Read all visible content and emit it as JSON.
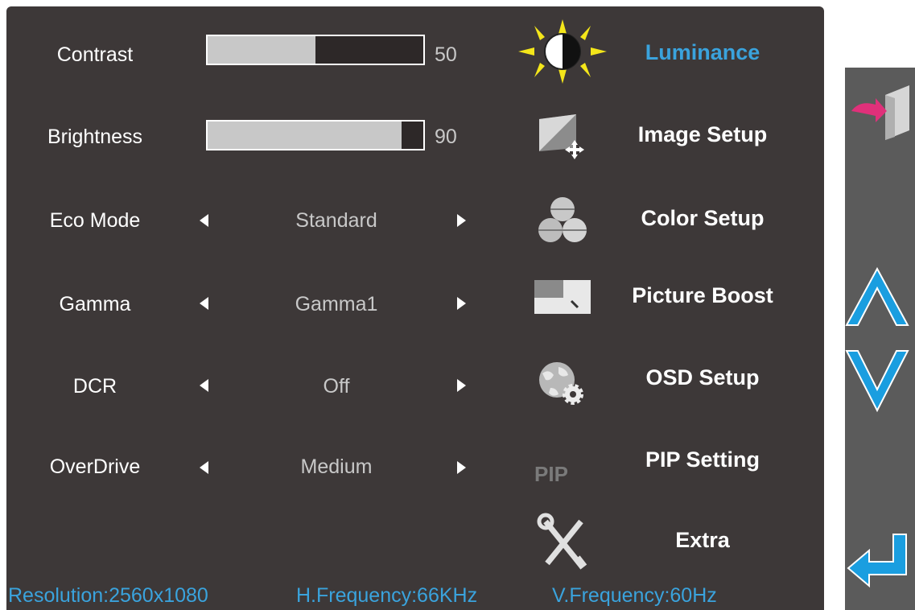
{
  "items": {
    "contrast": {
      "label": "Contrast",
      "value": "50",
      "level": 0.5
    },
    "brightness": {
      "label": "Brightness",
      "value": "90",
      "level": 0.9
    },
    "eco_mode": {
      "label": "Eco Mode",
      "value": "Standard"
    },
    "gamma": {
      "label": "Gamma",
      "value": "Gamma1"
    },
    "dcr": {
      "label": "DCR",
      "value": "Off"
    },
    "overdrive": {
      "label": "OverDrive",
      "value": "Medium"
    }
  },
  "menu": [
    {
      "label": "Luminance",
      "icon": "sun-icon",
      "active": true
    },
    {
      "label": "Image Setup",
      "icon": "image-setup-icon",
      "active": false
    },
    {
      "label": "Color Setup",
      "icon": "color-balls-icon",
      "active": false
    },
    {
      "label": "Picture Boost",
      "icon": "picture-boost-icon",
      "active": false
    },
    {
      "label": "OSD Setup",
      "icon": "globe-gear-icon",
      "active": false
    },
    {
      "label": "PIP Setting",
      "icon": "pip-icon",
      "icon_text": "PIP",
      "active": false
    },
    {
      "label": "Extra",
      "icon": "tools-icon",
      "active": false
    }
  ],
  "status": {
    "resolution": "Resolution:2560x1080",
    "h_frequency": "H.Frequency:66KHz",
    "v_frequency": "V.Frequency:60Hz"
  },
  "side_buttons": [
    "exit-icon",
    "up-arrow-icon",
    "down-arrow-icon",
    "enter-icon"
  ],
  "colors": {
    "background": "#3d3838",
    "accent": "#3aa3dd",
    "text": "#ffffff",
    "value_text": "#c8c8c8",
    "side_panel": "#5b5b5b",
    "exit_pink": "#e0307a"
  }
}
